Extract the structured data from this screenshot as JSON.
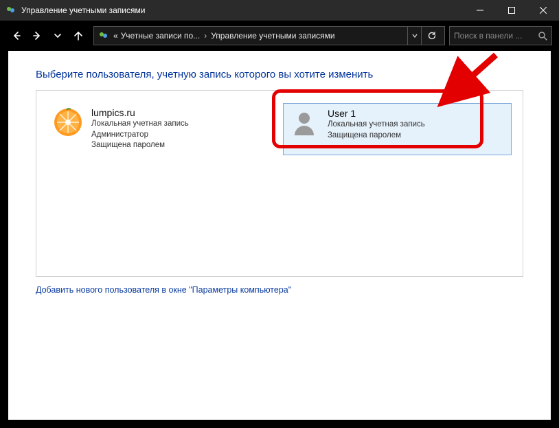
{
  "titlebar": {
    "title": "Управление учетными записями"
  },
  "breadcrumb": {
    "prefix": "«",
    "seg1": "Учетные записи по...",
    "seg2": "Управление учетными записями"
  },
  "search": {
    "placeholder": "Поиск в панели ..."
  },
  "page": {
    "heading": "Выберите пользователя, учетную запись которого вы хотите изменить",
    "addLink": "Добавить нового пользователя в окне \"Параметры компьютера\""
  },
  "users": [
    {
      "name": "lumpics.ru",
      "line1": "Локальная учетная запись",
      "line2": "Администратор",
      "line3": "Защищена паролем",
      "selected": false,
      "avatar": "orange"
    },
    {
      "name": "User 1",
      "line1": "Локальная учетная запись",
      "line2": "Защищена паролем",
      "line3": "",
      "selected": true,
      "avatar": "person"
    }
  ]
}
